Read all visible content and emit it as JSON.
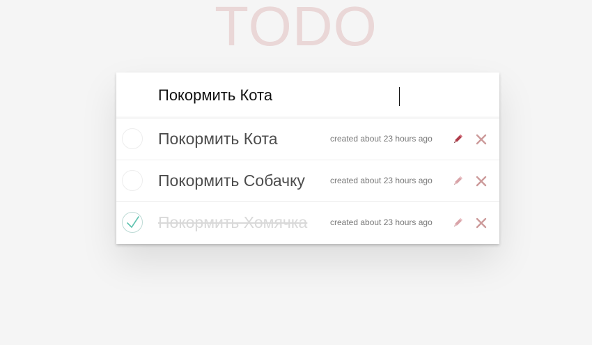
{
  "app": {
    "title": "TODO"
  },
  "new_todo": {
    "value": "Покормить Кота",
    "placeholder": ""
  },
  "todos": [
    {
      "label": "Покормить Кота",
      "created": "created about 23 hours ago",
      "completed": false
    },
    {
      "label": "Покормить Собачку",
      "created": "created about 23 hours ago",
      "completed": false
    },
    {
      "label": "Покормить Хомячка",
      "created": "created about 23 hours ago",
      "completed": true
    }
  ],
  "icons": {
    "edit": "pencil-icon",
    "destroy": "close-icon",
    "check": "checkmark-icon"
  },
  "colors": {
    "title": "#efd9d9",
    "edit_active": "#af3c4a",
    "edit_muted": "#d9a3a8",
    "destroy": "#cc9a9a",
    "check": "#5dc2af"
  }
}
